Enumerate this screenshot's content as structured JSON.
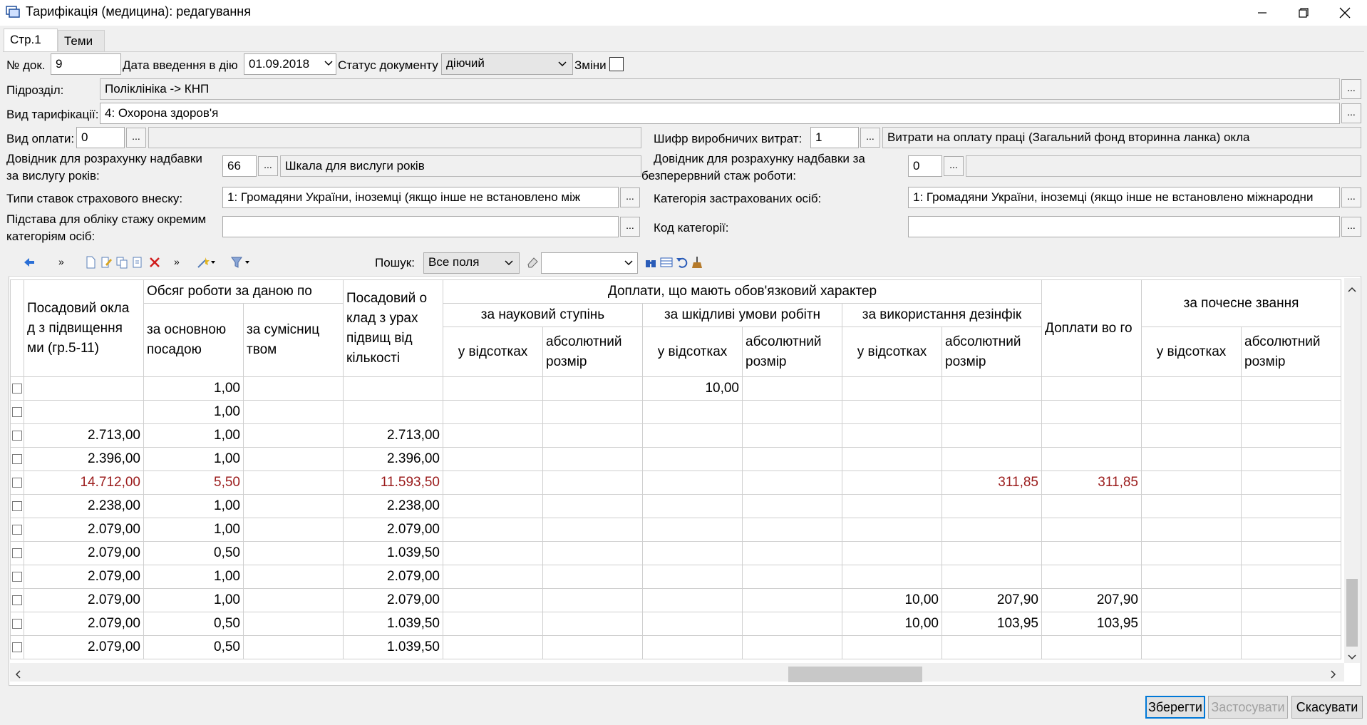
{
  "window": {
    "title": "Тарифікація (медицина): редагування"
  },
  "tabs": [
    {
      "label": "Стр.1"
    },
    {
      "label": "Теми"
    }
  ],
  "form": {
    "doc_no_label": "№ док.",
    "doc_no": "9",
    "date_label": "Дата введення в дію",
    "date": "01.09.2018",
    "status_label": "Статус документу",
    "status": "діючий",
    "changes_label": "Зміни",
    "subdivision_label": "Підрозділ:",
    "subdivision": "Поліклініка -> КНП",
    "tariff_type_label": "Вид тарифікації:",
    "tariff_type": "4: Охорона здоров'я",
    "pay_type_label": "Вид оплати:",
    "pay_type": "0",
    "cost_code_label": "Шифр виробничих витрат:",
    "cost_code": "1",
    "cost_code_name": "Витрати на оплату праці (Загальний фонд вторинна ланка) окла",
    "seniority_ref_label_1": "Довідник для розрахунку надбавки",
    "seniority_ref_label_2": "за вислугу років:",
    "seniority_ref": "66",
    "seniority_ref_name": "Шкала для вислуги років",
    "continuous_ref_label_1": "Довідник для розрахунку надбавки за",
    "continuous_ref_label_2": "безперервний стаж роботи:",
    "continuous_ref": "0",
    "insurance_types_label": "Типи ставок страхового внеску:",
    "insurance_types": "1: Громадяни України,  іноземці  (якщо  інше  не  встановлено між",
    "insured_category_label": "Категорія застрахованих осіб:",
    "insured_category": "1: Громадяни України, іноземці (якщо інше не встановлено міжнародни",
    "basis_label_1": "Підстава для обліку стажу окремим",
    "basis_label_2": "категоріям осіб:",
    "category_code_label": "Код категорії:"
  },
  "toolbar": {
    "search_label": "Пошук:",
    "search_scope": "Все поля"
  },
  "grid": {
    "headers": {
      "salary": "Посадовий окла д з підвищення ми (гр.5-11)",
      "workload": "Обсяг роботи за даною по",
      "workload_main": "за основною посадою",
      "workload_combo": "за сумісниц твом",
      "salary_adj": "Посадовий о клад з урах підвищ від кількості",
      "mandatory": "Доплати, що мають обов'язковий характер",
      "degree": "за науковий ступінь",
      "harmful": "за шкідливі умови робітн",
      "disinfect": "за використання дезінфік",
      "percent": "у відсотках",
      "absolute": "абсолютний розмір",
      "extra_total": "Доплати во го",
      "honorary": "за почесне звання"
    },
    "rows": [
      [
        "",
        "1,00",
        "",
        "",
        "",
        "",
        "10,00",
        "",
        "",
        "",
        "",
        "",
        ""
      ],
      [
        "",
        "1,00",
        "",
        "",
        "",
        "",
        "",
        "",
        "",
        "",
        "",
        "",
        ""
      ],
      [
        "2.713,00",
        "1,00",
        "",
        "2.713,00",
        "",
        "",
        "",
        "",
        "",
        "",
        "",
        "",
        ""
      ],
      [
        "2.396,00",
        "1,00",
        "",
        "2.396,00",
        "",
        "",
        "",
        "",
        "",
        "",
        "",
        "",
        ""
      ],
      [
        "14.712,00",
        "5,50",
        "",
        "11.593,50",
        "",
        "",
        "",
        "",
        "",
        "311,85",
        "311,85",
        "",
        ""
      ],
      [
        "2.238,00",
        "1,00",
        "",
        "2.238,00",
        "",
        "",
        "",
        "",
        "",
        "",
        "",
        "",
        ""
      ],
      [
        "2.079,00",
        "1,00",
        "",
        "2.079,00",
        "",
        "",
        "",
        "",
        "",
        "",
        "",
        "",
        ""
      ],
      [
        "2.079,00",
        "0,50",
        "",
        "1.039,50",
        "",
        "",
        "",
        "",
        "",
        "",
        "",
        "",
        ""
      ],
      [
        "2.079,00",
        "1,00",
        "",
        "2.079,00",
        "",
        "",
        "",
        "",
        "",
        "",
        "",
        "",
        ""
      ],
      [
        "2.079,00",
        "1,00",
        "",
        "2.079,00",
        "",
        "",
        "",
        "",
        "10,00",
        "207,90",
        "207,90",
        "",
        ""
      ],
      [
        "2.079,00",
        "0,50",
        "",
        "1.039,50",
        "",
        "",
        "",
        "",
        "10,00",
        "103,95",
        "103,95",
        "",
        ""
      ],
      [
        "2.079,00",
        "0,50",
        "",
        "1.039,50",
        "",
        "",
        "",
        "",
        "",
        "",
        "",
        "",
        ""
      ]
    ],
    "highlight_row": 4
  },
  "buttons": {
    "save": "Зберегти",
    "apply": "Застосувати",
    "cancel": "Скасувати"
  },
  "colors": {
    "accent": "#0078d7",
    "highlight_text": "#9b1c1c"
  }
}
